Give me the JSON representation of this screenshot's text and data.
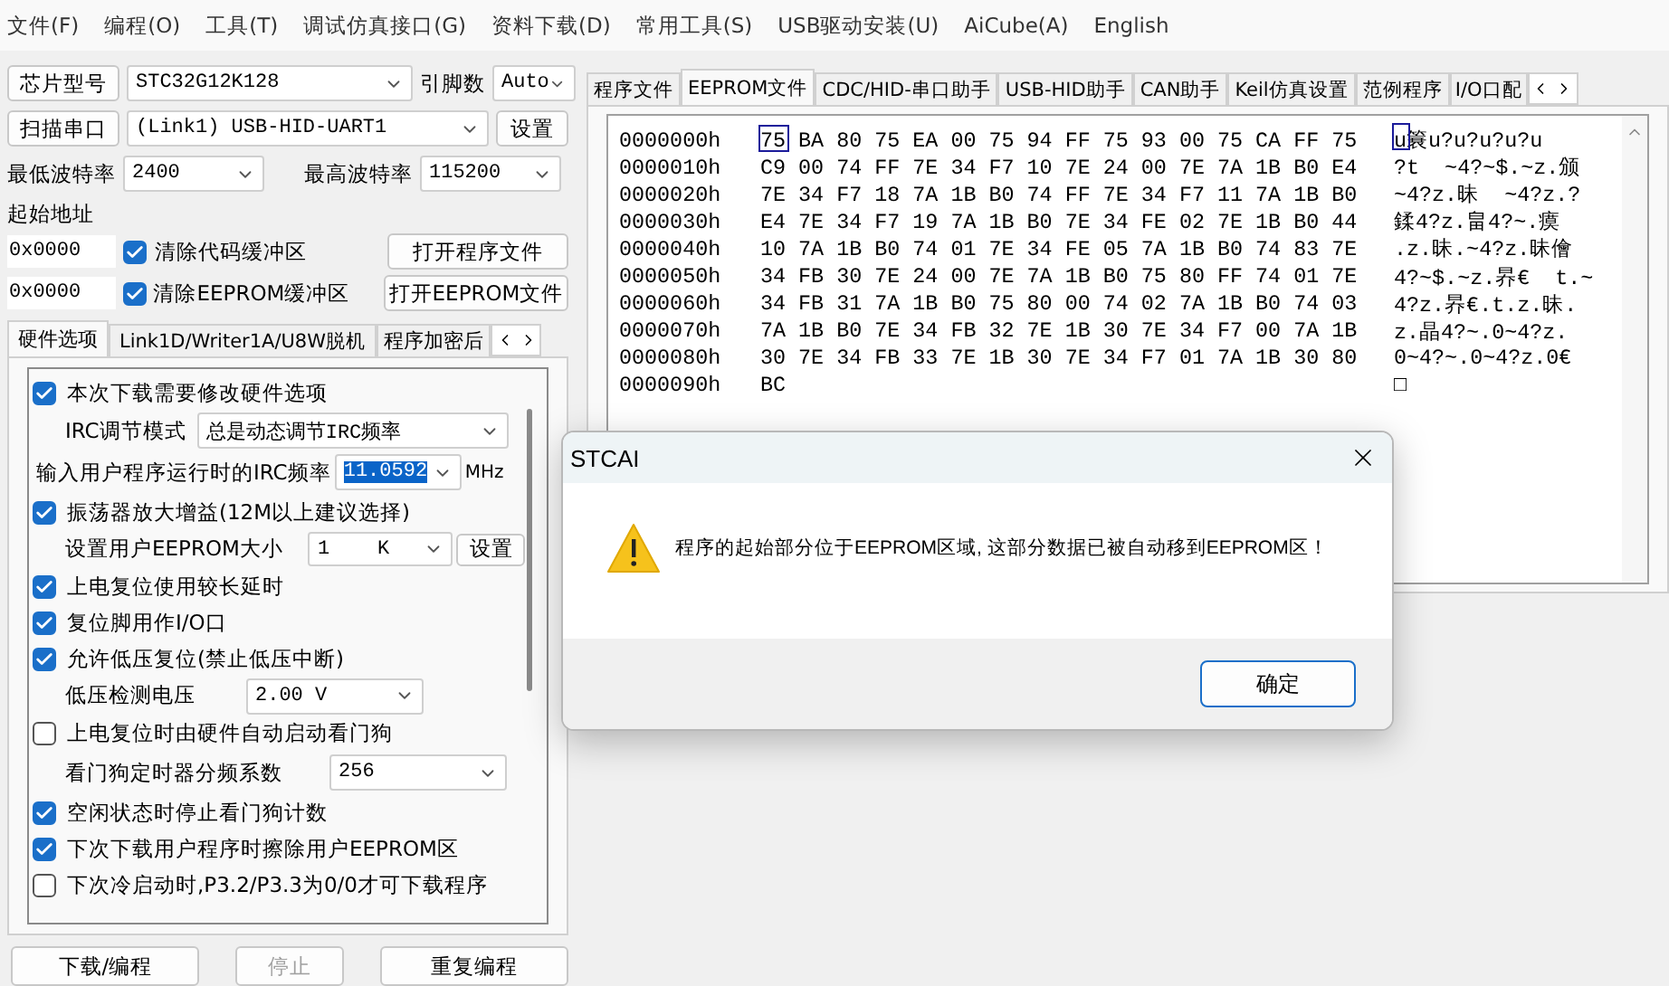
{
  "menu": [
    "文件(F)",
    "编程(O)",
    "工具(T)",
    "调试仿真接口(G)",
    "资料下载(D)",
    "常用工具(S)",
    "USB驱动安装(U)",
    "AiCube(A)",
    "English"
  ],
  "chip_row": {
    "button": "芯片型号",
    "chip": "STC32G12K128",
    "pins_label": "引脚数",
    "pins": "Auto"
  },
  "port_row": {
    "button": "扫描串口",
    "port": "(Link1) USB-HID-UART1",
    "settings": "设置"
  },
  "baud_row": {
    "min_label": "最低波特率",
    "min": "2400",
    "max_label": "最高波特率",
    "max": "115200"
  },
  "start_address": {
    "label": "起始地址",
    "rows": [
      {
        "address": "0x0000",
        "option": "清除代码缓冲区",
        "checked": true,
        "button": "打开程序文件"
      },
      {
        "address": "0x0000",
        "option": "清除EEPROM缓冲区",
        "checked": true,
        "button": "打开EEPROM文件"
      }
    ]
  },
  "left_tabs": [
    {
      "label": "硬件选项",
      "selected": true
    },
    {
      "label": "Link1D/Writer1A/U8W脱机",
      "selected": false
    },
    {
      "label": "程序加密后",
      "selected": false
    }
  ],
  "hardware_options": [
    {
      "kind": "checkbox",
      "label": "本次下载需要修改硬件选项",
      "checked": true
    },
    {
      "kind": "select",
      "label": "IRC调节模式",
      "value": "总是动态调节IRC频率"
    },
    {
      "kind": "frequency",
      "label": "输入用户程序运行时的IRC频率",
      "value": "11.0592",
      "unit": "MHz"
    },
    {
      "kind": "checkbox",
      "label": "振荡器放大增益(12M以上建议选择)",
      "checked": true
    },
    {
      "kind": "select_button",
      "label": "设置用户EEPROM大小",
      "value": "1    K",
      "button": "设置"
    },
    {
      "kind": "checkbox",
      "label": "上电复位使用较长延时",
      "checked": true
    },
    {
      "kind": "checkbox",
      "label": "复位脚用作I/O口",
      "checked": true
    },
    {
      "kind": "checkbox",
      "label": "允许低压复位(禁止低压中断)",
      "checked": true
    },
    {
      "kind": "select",
      "label": "低压检测电压",
      "value": "2.00 V"
    },
    {
      "kind": "checkbox",
      "label": "上电复位时由硬件自动启动看门狗",
      "checked": false
    },
    {
      "kind": "select",
      "label": "看门狗定时器分频系数",
      "value": "256"
    },
    {
      "kind": "checkbox",
      "label": "空闲状态时停止看门狗计数",
      "checked": true
    },
    {
      "kind": "checkbox",
      "label": "下次下载用户程序时擦除用户EEPROM区",
      "checked": true
    },
    {
      "kind": "checkbox",
      "label": "下次冷启动时,P3.2/P3.3为0/0才可下载程序",
      "checked": false
    }
  ],
  "actions": [
    {
      "label": "下载/编程",
      "disabled": false
    },
    {
      "label": "停止",
      "disabled": true
    },
    {
      "label": "重复编程",
      "disabled": false
    }
  ],
  "right_tabs": [
    {
      "label": "程序文件",
      "selected": false
    },
    {
      "label": "EEPROM文件",
      "selected": true
    },
    {
      "label": "CDC/HID-串口助手",
      "selected": false
    },
    {
      "label": "USB-HID助手",
      "selected": false
    },
    {
      "label": "CAN助手",
      "selected": false
    },
    {
      "label": "Keil仿真设置",
      "selected": false
    },
    {
      "label": "范例程序",
      "selected": false
    },
    {
      "label": "I/O口配",
      "selected": false
    }
  ],
  "hex_view": {
    "rows": [
      {
        "address": "0000000h",
        "bytes": "75 BA 80 75 EA 00 75 94 FF 75 93 00 75 CA FF 75",
        "ascii": "u簔u?u?u?u?u",
        "cursor": true
      },
      {
        "address": "0000010h",
        "bytes": "C9 00 74 FF 7E 34 F7 10 7E 24 00 7E 7A 1B B0 E4",
        "ascii": "?t  ~4?~$.~z.颁",
        "cursor": false
      },
      {
        "address": "0000020h",
        "bytes": "7E 34 F7 18 7A 1B B0 74 FF 7E 34 F7 11 7A 1B B0",
        "ascii": "~4?z.昧  ~4?z.?",
        "cursor": false
      },
      {
        "address": "0000030h",
        "bytes": "E4 7E 34 F7 19 7A 1B B0 7E 34 FE 02 7E 1B B0 44",
        "ascii": "鍒4?z.畠4?~.瘼",
        "cursor": false
      },
      {
        "address": "0000040h",
        "bytes": "10 7A 1B B0 74 01 7E 34 FE 05 7A 1B B0 74 83 7E",
        "ascii": ".z.昧.~4?z.昧儈",
        "cursor": false
      },
      {
        "address": "0000050h",
        "bytes": "34 FB 30 7E 24 00 7E 7A 1B B0 75 80 FF 74 01 7E",
        "ascii": "4?~$.~z.昦€  t.~",
        "cursor": false
      },
      {
        "address": "0000060h",
        "bytes": "34 FB 31 7A 1B B0 75 80 00 74 02 7A 1B B0 74 03",
        "ascii": "4?z.昦€.t.z.昧.",
        "cursor": false
      },
      {
        "address": "0000070h",
        "bytes": "7A 1B B0 7E 34 FB 32 7E 1B 30 7E 34 F7 00 7A 1B",
        "ascii": "z.晶4?~.0~4?z.",
        "cursor": false
      },
      {
        "address": "0000080h",
        "bytes": "30 7E 34 FB 33 7E 1B 30 7E 34 F7 01 7A 1B 30 80",
        "ascii": "0~4?~.0~4?z.0€",
        "cursor": false
      },
      {
        "address": "0000090h",
        "bytes": "BC",
        "ascii": "□",
        "cursor": false
      }
    ]
  },
  "dialog": {
    "title": "STCAI",
    "message": "程序的起始部分位于EEPROM区域, 这部分数据已被自动移到EEPROM区！",
    "button": "确定"
  }
}
